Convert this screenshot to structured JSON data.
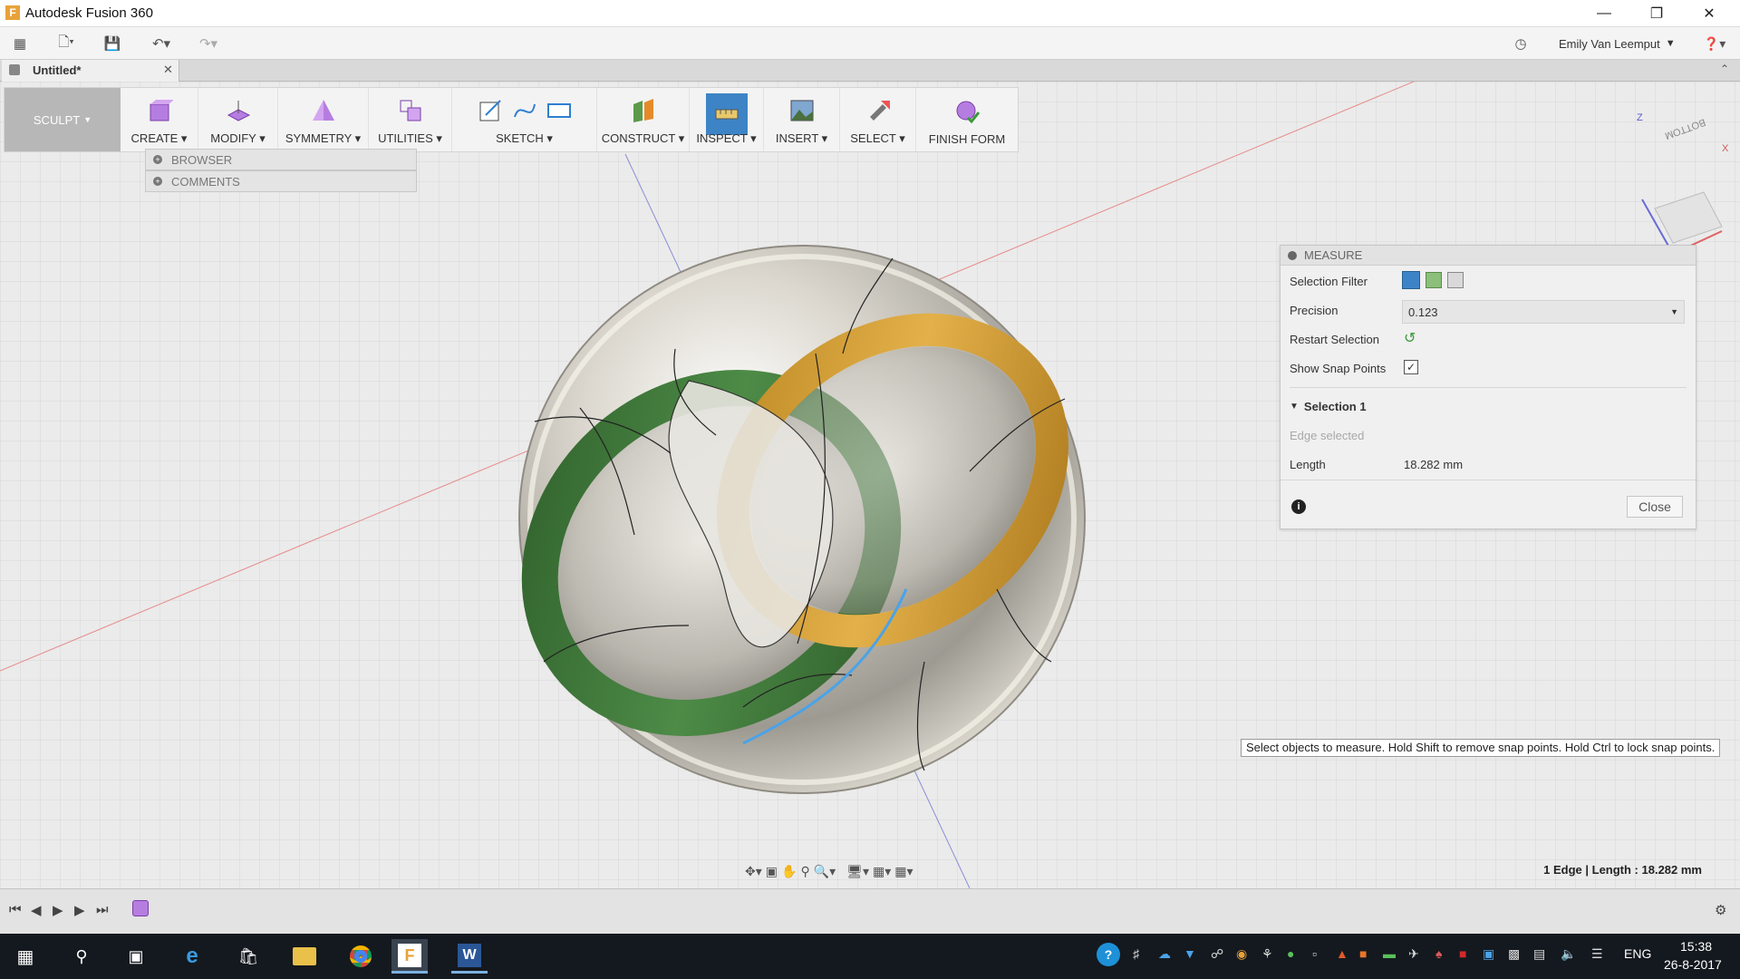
{
  "window": {
    "title": "Autodesk Fusion 360"
  },
  "user": {
    "name": "Emily Van Leemput"
  },
  "tab": {
    "title": "Untitled*"
  },
  "toolbar": {
    "workspace": "SCULPT",
    "groups": [
      {
        "label": "CREATE"
      },
      {
        "label": "MODIFY"
      },
      {
        "label": "SYMMETRY"
      },
      {
        "label": "UTILITIES"
      },
      {
        "label": "SKETCH"
      },
      {
        "label": "CONSTRUCT"
      },
      {
        "label": "INSPECT"
      },
      {
        "label": "INSERT"
      },
      {
        "label": "SELECT"
      },
      {
        "label": "FINISH FORM"
      }
    ]
  },
  "browser": {
    "browser_label": "BROWSER",
    "comments_label": "COMMENTS"
  },
  "viewcube": {
    "face": "BOTTOM",
    "axis_z": "Z",
    "axis_x": "X"
  },
  "measure": {
    "title": "MEASURE",
    "selection_filter_label": "Selection Filter",
    "precision_label": "Precision",
    "precision_value": "0.123",
    "restart_label": "Restart Selection",
    "snap_label": "Show Snap Points",
    "snap_checked": true,
    "section_title": "Selection 1",
    "edge_selected": "Edge selected",
    "length_label": "Length",
    "length_value": "18.282 mm",
    "close_label": "Close"
  },
  "tooltip": "Select objects to measure. Hold Shift to remove snap points. Hold Ctrl to lock snap points.",
  "status": "1 Edge | Length : 18.282 mm",
  "taskbar": {
    "language": "ENG",
    "time": "15:38",
    "date": "26-8-2017"
  },
  "colors": {
    "accent": "#2f7fd0",
    "green_band": "#3f7a3a",
    "yellow_band": "#d5a23a",
    "body": "#c9c6bd"
  }
}
